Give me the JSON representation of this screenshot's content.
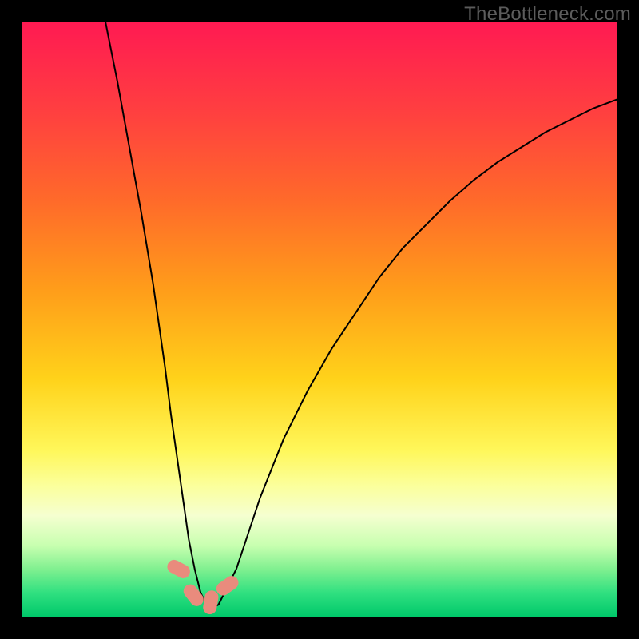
{
  "watermark": "TheBottleneck.com",
  "chart_data": {
    "type": "line",
    "title": "",
    "xlabel": "",
    "ylabel": "",
    "xlim": [
      0,
      100
    ],
    "ylim": [
      0,
      100
    ],
    "grid": false,
    "legend": false,
    "background_gradient": {
      "stops": [
        {
          "offset": 0.0,
          "color": "#ff1a52"
        },
        {
          "offset": 0.15,
          "color": "#ff3f40"
        },
        {
          "offset": 0.3,
          "color": "#ff6a2a"
        },
        {
          "offset": 0.45,
          "color": "#ff9d1a"
        },
        {
          "offset": 0.6,
          "color": "#ffd21a"
        },
        {
          "offset": 0.72,
          "color": "#fff75a"
        },
        {
          "offset": 0.78,
          "color": "#fbff9c"
        },
        {
          "offset": 0.83,
          "color": "#f5ffd0"
        },
        {
          "offset": 0.88,
          "color": "#c8ffb0"
        },
        {
          "offset": 0.92,
          "color": "#80f090"
        },
        {
          "offset": 0.96,
          "color": "#30e080"
        },
        {
          "offset": 1.0,
          "color": "#00c86a"
        }
      ]
    },
    "series": [
      {
        "name": "bottleneck-curve",
        "color": "#000000",
        "x": [
          14,
          16,
          18,
          20,
          22,
          24,
          25,
          26,
          27,
          28,
          29,
          30,
          31,
          32,
          33,
          34,
          36,
          38,
          40,
          44,
          48,
          52,
          56,
          60,
          64,
          68,
          72,
          76,
          80,
          84,
          88,
          92,
          96,
          100
        ],
        "y": [
          100,
          90,
          79,
          68,
          56,
          42,
          34,
          27,
          20,
          13,
          8,
          4,
          2,
          1.5,
          2,
          4,
          8,
          14,
          20,
          30,
          38,
          45,
          51,
          57,
          62,
          66,
          70,
          73.5,
          76.5,
          79,
          81.5,
          83.5,
          85.5,
          87
        ]
      }
    ],
    "markers": [
      {
        "name": "marker-1",
        "x": 26.3,
        "y": 8.0,
        "color": "#e98b7d",
        "rotation": -62
      },
      {
        "name": "marker-2",
        "x": 28.8,
        "y": 3.6,
        "color": "#e98b7d",
        "rotation": -38
      },
      {
        "name": "marker-3",
        "x": 31.7,
        "y": 2.4,
        "color": "#e98b7d",
        "rotation": 10
      },
      {
        "name": "marker-4",
        "x": 34.5,
        "y": 5.2,
        "color": "#e98b7d",
        "rotation": 55
      }
    ]
  }
}
